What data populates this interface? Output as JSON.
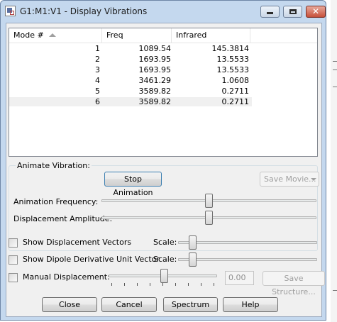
{
  "window": {
    "title": "G1:M1:V1 - Display Vibrations"
  },
  "title_buttons": {
    "minimize": "minimize-icon",
    "maximize": "maximize-icon",
    "close": "close-icon"
  },
  "table": {
    "columns": [
      "Mode #",
      "Freq",
      "Infrared"
    ],
    "rows": [
      {
        "mode": "1",
        "freq": "1089.54",
        "ir": "145.3814"
      },
      {
        "mode": "2",
        "freq": "1693.95",
        "ir": "13.5533"
      },
      {
        "mode": "3",
        "freq": "1693.95",
        "ir": "13.5533"
      },
      {
        "mode": "4",
        "freq": "3461.29",
        "ir": "1.0608"
      },
      {
        "mode": "5",
        "freq": "3589.82",
        "ir": "0.2711"
      },
      {
        "mode": "6",
        "freq": "3589.82",
        "ir": "0.2711"
      }
    ]
  },
  "animate": {
    "group_label": "Animate Vibration:",
    "stop_button": "Stop Animation",
    "save_movie": "Save Movie...",
    "frequency_label": "Animation Frequency:",
    "frequency_level": 0.5,
    "amplitude_label": "Displacement Amplitude:",
    "amplitude_level": 0.5
  },
  "options": {
    "show_displacement_vectors": "Show Displacement Vectors",
    "show_dipole_vector": "Show Dipole Derivative Unit Vector",
    "scale_label": "Scale:",
    "manual_displacement": "Manual Displacement:",
    "manual_value": "0.00",
    "save_structure": "Save Structure..."
  },
  "buttons": {
    "close": "Close",
    "cancel": "Cancel",
    "spectrum": "Spectrum",
    "help": "Help"
  }
}
